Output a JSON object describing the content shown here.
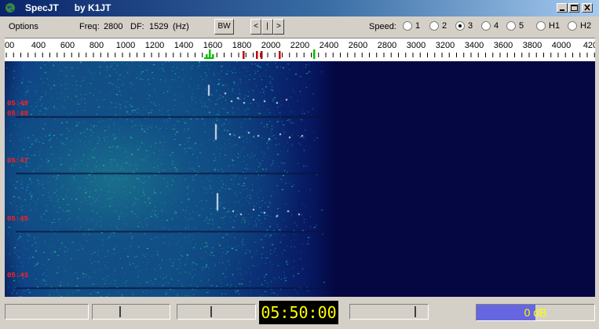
{
  "window": {
    "app_name": "SpecJT",
    "author": "by K1JT",
    "title_color": "#0a246a"
  },
  "toolbar": {
    "options_label": "Options",
    "freq_label": "Freq:",
    "freq_value": "2800",
    "df_label": "DF:",
    "df_value": "1529",
    "df_unit": "(Hz)",
    "bw_label": "BW",
    "nav_left": "<",
    "nav_center": "|",
    "nav_right": ">",
    "speed_label": "Speed:",
    "speed_options": [
      "1",
      "2",
      "3",
      "4",
      "5",
      "H1",
      "H2"
    ],
    "speed_selected": "3"
  },
  "scale": {
    "labels": [
      "00",
      "400",
      "600",
      "800",
      "1000",
      "1200",
      "1400",
      "1600",
      "1800",
      "2000",
      "2200",
      "2400",
      "2600",
      "2800",
      "3000",
      "3200",
      "3400",
      "3600",
      "3800",
      "4000",
      "420"
    ],
    "green_marker_color": "#00c000",
    "red_marker_color": "#c00000"
  },
  "waterfall": {
    "time_stamps": [
      "05:49",
      "05:48",
      "05:47",
      "05:45",
      "05:43"
    ],
    "time_color": "#ff2020"
  },
  "status": {
    "clock": "05:50:00",
    "level_text": "0 dB",
    "level_fraction": 0.5,
    "level_color": "#6666e0"
  }
}
